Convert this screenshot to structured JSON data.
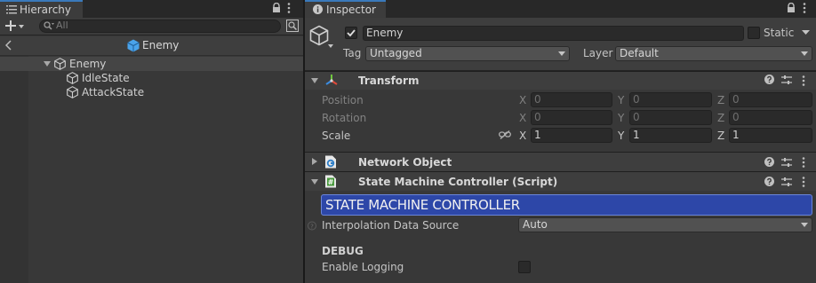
{
  "hierarchy": {
    "tab_label": "Hierarchy",
    "search_placeholder": "All",
    "scene_title": "Enemy",
    "tree": [
      {
        "label": "Enemy"
      },
      {
        "label": "IdleState"
      },
      {
        "label": "AttackState"
      }
    ]
  },
  "inspector": {
    "tab_label": "Inspector",
    "object_name": "Enemy",
    "active": true,
    "static_label": "Static",
    "tag_label": "Tag",
    "tag_value": "Untagged",
    "layer_label": "Layer",
    "layer_value": "Default",
    "components": {
      "transform": {
        "title": "Transform",
        "rows": [
          {
            "label": "Position",
            "x": "0",
            "y": "0",
            "z": "0"
          },
          {
            "label": "Rotation",
            "x": "0",
            "y": "0",
            "z": "0"
          },
          {
            "label": "Scale",
            "x": "1",
            "y": "1",
            "z": "1"
          }
        ],
        "axes": [
          "X",
          "Y",
          "Z"
        ]
      },
      "network_object": {
        "title": "Network Object"
      },
      "state_machine": {
        "title": "State Machine Controller (Script)",
        "banner": "STATE MACHINE CONTROLLER",
        "interp_label": "Interpolation Data Source",
        "interp_value": "Auto",
        "debug_header": "DEBUG",
        "logging_label": "Enable Logging"
      }
    }
  },
  "colors": {
    "accent_tab": "#3a79bb",
    "banner_bg": "#2d47a8",
    "cube_icon": "#4aa3ea"
  }
}
